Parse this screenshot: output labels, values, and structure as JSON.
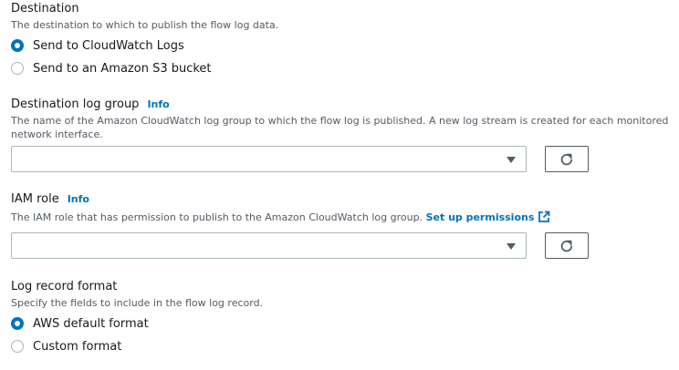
{
  "destination": {
    "label": "Destination",
    "description": "The destination to which to publish the flow log data.",
    "options": [
      {
        "label": "Send to CloudWatch Logs",
        "selected": true
      },
      {
        "label": "Send to an Amazon S3 bucket",
        "selected": false
      }
    ]
  },
  "log_group": {
    "label": "Destination log group",
    "info": "Info",
    "description_line1": "The name of the Amazon CloudWatch log group to which the flow log is published. A new log stream is created for each monitored",
    "description_line2": "network interface.",
    "value": ""
  },
  "iam_role": {
    "label": "IAM role",
    "info": "Info",
    "description": "The IAM role that has permission to publish to the Amazon CloudWatch log group.",
    "link": "Set up permissions",
    "value": ""
  },
  "log_format": {
    "label": "Log record format",
    "description": "Specify the fields to include in the flow log record.",
    "options": [
      {
        "label": "AWS default format",
        "selected": true
      },
      {
        "label": "Custom format",
        "selected": false
      }
    ]
  },
  "icons": {
    "refresh": "refresh-icon",
    "external_link": "external-link-icon",
    "dropdown": "caret-down-icon"
  },
  "colors": {
    "accent": "#0073bb",
    "text": "#16191f",
    "secondary_text": "#545b64",
    "border": "#aab7b8"
  }
}
